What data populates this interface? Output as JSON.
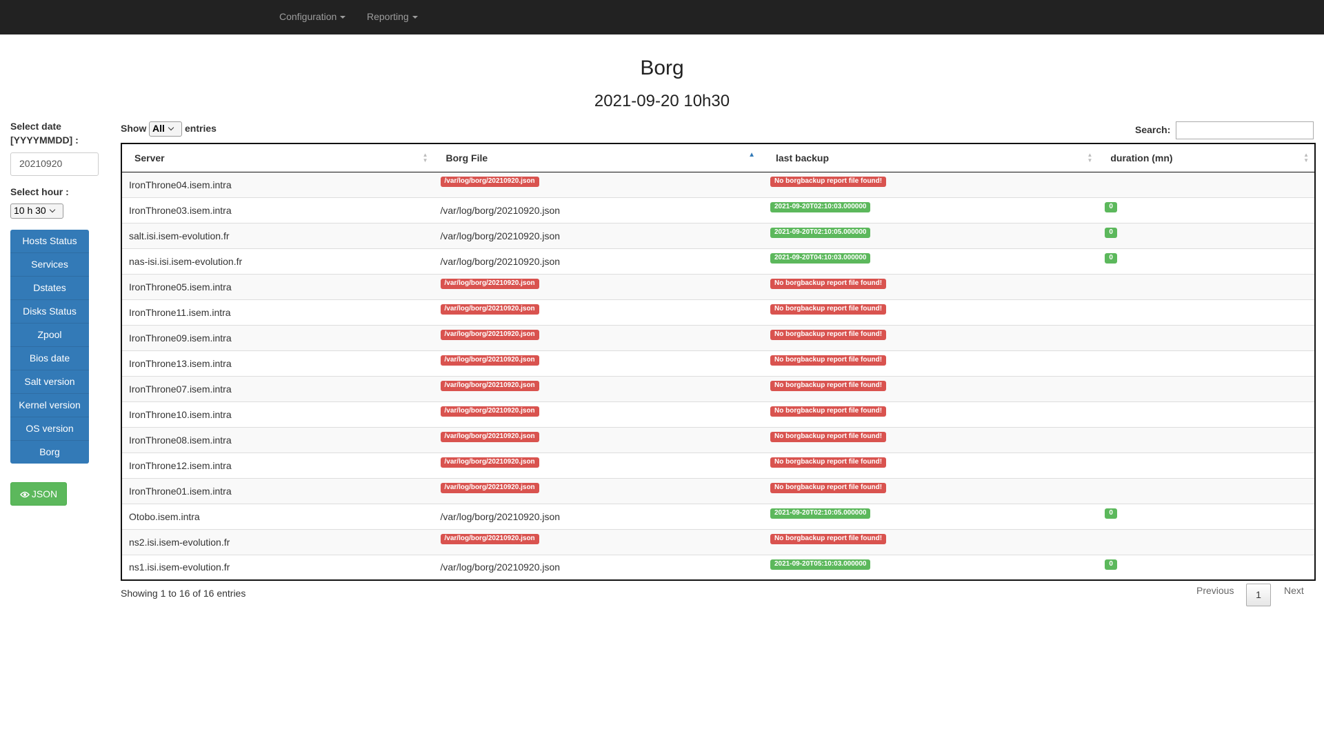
{
  "nav": {
    "configuration_label": "Configuration",
    "reporting_label": "Reporting"
  },
  "page": {
    "title": "Borg",
    "subtitle": "2021-09-20 10h30"
  },
  "sidebar": {
    "date_label": "Select date [YYYYMMDD] :",
    "date_value": "20210920",
    "hour_label": "Select hour :",
    "hour_value": "10 h 30",
    "menu": [
      "Hosts Status",
      "Services",
      "Dstates",
      "Disks Status",
      "Zpool",
      "Bios date",
      "Salt version",
      "Kernel version",
      "OS version",
      "Borg"
    ],
    "json_label": "JSON"
  },
  "table_controls": {
    "show_label": "Show",
    "length_value": "All",
    "entries_label": "entries",
    "search_label": "Search:"
  },
  "table": {
    "columns": [
      "Server",
      "Borg File",
      "last backup",
      "duration (mn)"
    ],
    "sorted_column": "Borg File",
    "rows": [
      {
        "server": "IronThrone04.isem.intra",
        "file": "/var/log/borg/20210920.json",
        "file_status": "danger",
        "last_backup": "No borgbackup report file found!",
        "backup_status": "danger",
        "duration": ""
      },
      {
        "server": "IronThrone03.isem.intra",
        "file": "/var/log/borg/20210920.json",
        "file_status": "ok",
        "last_backup": "2021-09-20T02:10:03.000000",
        "backup_status": "success",
        "duration": "0"
      },
      {
        "server": "salt.isi.isem-evolution.fr",
        "file": "/var/log/borg/20210920.json",
        "file_status": "ok",
        "last_backup": "2021-09-20T02:10:05.000000",
        "backup_status": "success",
        "duration": "0"
      },
      {
        "server": "nas-isi.isi.isem-evolution.fr",
        "file": "/var/log/borg/20210920.json",
        "file_status": "ok",
        "last_backup": "2021-09-20T04:10:03.000000",
        "backup_status": "success",
        "duration": "0"
      },
      {
        "server": "IronThrone05.isem.intra",
        "file": "/var/log/borg/20210920.json",
        "file_status": "danger",
        "last_backup": "No borgbackup report file found!",
        "backup_status": "danger",
        "duration": ""
      },
      {
        "server": "IronThrone11.isem.intra",
        "file": "/var/log/borg/20210920.json",
        "file_status": "danger",
        "last_backup": "No borgbackup report file found!",
        "backup_status": "danger",
        "duration": ""
      },
      {
        "server": "IronThrone09.isem.intra",
        "file": "/var/log/borg/20210920.json",
        "file_status": "danger",
        "last_backup": "No borgbackup report file found!",
        "backup_status": "danger",
        "duration": ""
      },
      {
        "server": "IronThrone13.isem.intra",
        "file": "/var/log/borg/20210920.json",
        "file_status": "danger",
        "last_backup": "No borgbackup report file found!",
        "backup_status": "danger",
        "duration": ""
      },
      {
        "server": "IronThrone07.isem.intra",
        "file": "/var/log/borg/20210920.json",
        "file_status": "danger",
        "last_backup": "No borgbackup report file found!",
        "backup_status": "danger",
        "duration": ""
      },
      {
        "server": "IronThrone10.isem.intra",
        "file": "/var/log/borg/20210920.json",
        "file_status": "danger",
        "last_backup": "No borgbackup report file found!",
        "backup_status": "danger",
        "duration": ""
      },
      {
        "server": "IronThrone08.isem.intra",
        "file": "/var/log/borg/20210920.json",
        "file_status": "danger",
        "last_backup": "No borgbackup report file found!",
        "backup_status": "danger",
        "duration": ""
      },
      {
        "server": "IronThrone12.isem.intra",
        "file": "/var/log/borg/20210920.json",
        "file_status": "danger",
        "last_backup": "No borgbackup report file found!",
        "backup_status": "danger",
        "duration": ""
      },
      {
        "server": "IronThrone01.isem.intra",
        "file": "/var/log/borg/20210920.json",
        "file_status": "danger",
        "last_backup": "No borgbackup report file found!",
        "backup_status": "danger",
        "duration": ""
      },
      {
        "server": "Otobo.isem.intra",
        "file": "/var/log/borg/20210920.json",
        "file_status": "ok",
        "last_backup": "2021-09-20T02:10:05.000000",
        "backup_status": "success",
        "duration": "0"
      },
      {
        "server": "ns2.isi.isem-evolution.fr",
        "file": "/var/log/borg/20210920.json",
        "file_status": "danger",
        "last_backup": "No borgbackup report file found!",
        "backup_status": "danger",
        "duration": ""
      },
      {
        "server": "ns1.isi.isem-evolution.fr",
        "file": "/var/log/borg/20210920.json",
        "file_status": "ok",
        "last_backup": "2021-09-20T05:10:03.000000",
        "backup_status": "success",
        "duration": "0"
      }
    ]
  },
  "footer": {
    "info": "Showing 1 to 16 of 16 entries",
    "previous_label": "Previous",
    "current_page": "1",
    "next_label": "Next"
  },
  "colors": {
    "navbar": "#222222",
    "primary": "#337ab7",
    "success": "#5cb85c",
    "danger": "#d9534f"
  }
}
